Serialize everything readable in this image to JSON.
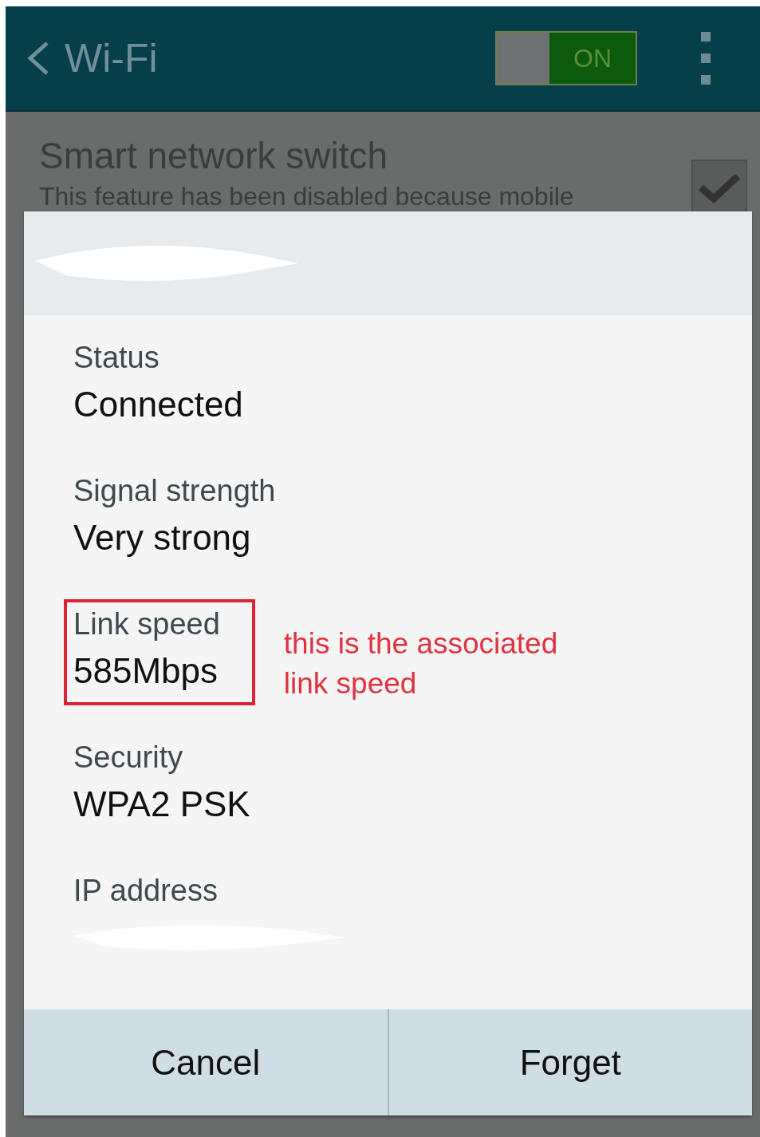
{
  "header": {
    "title": "Wi-Fi",
    "switch_on": true,
    "switch_label": "ON"
  },
  "background_setting": {
    "title": "Smart network switch",
    "description": "This feature has been disabled because mobile",
    "checked": true
  },
  "dialog": {
    "title_redacted": true,
    "details": [
      {
        "label": "Status",
        "value": "Connected",
        "highlighted": false
      },
      {
        "label": "Signal strength",
        "value": "Very strong",
        "highlighted": false
      },
      {
        "label": "Link speed",
        "value": "585Mbps",
        "highlighted": true
      },
      {
        "label": "Security",
        "value": "WPA2 PSK",
        "highlighted": false
      },
      {
        "label": "IP address",
        "redacted": true,
        "highlighted": false
      }
    ],
    "buttons": [
      "Cancel",
      "Forget"
    ]
  },
  "annotation": {
    "text": "this is the associated link speed"
  }
}
